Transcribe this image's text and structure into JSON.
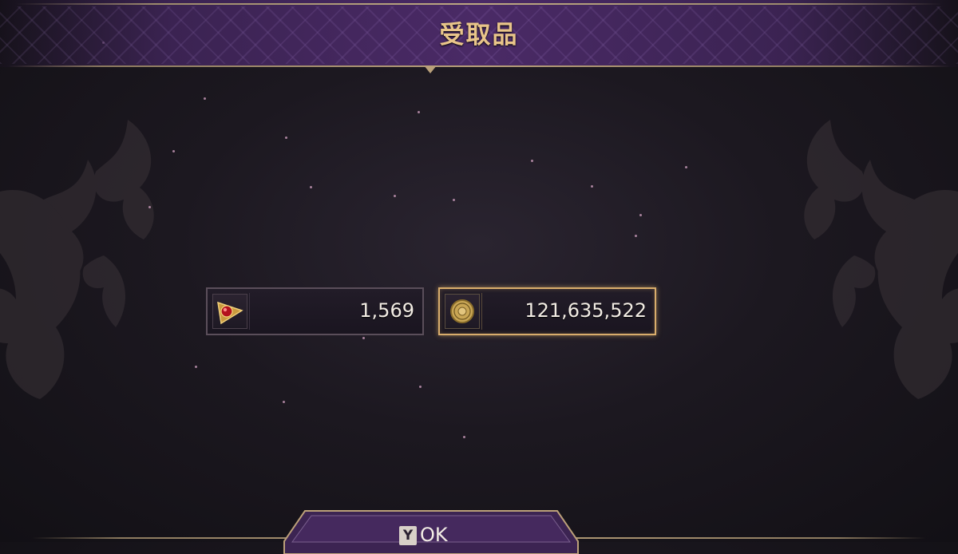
{
  "screen": {
    "title": "受取品"
  },
  "rewards": [
    {
      "icon": "red-gem-icon",
      "amount": "1,569",
      "selected": false
    },
    {
      "icon": "gold-coin-icon",
      "amount": "121,635,522",
      "selected": true
    }
  ],
  "ok_button": {
    "key_hint": "Y",
    "label": "OK"
  },
  "colors": {
    "title": "#e9c58a",
    "header_purple": "#4a2a66",
    "selected_border": "#d9ad6c",
    "background": "#1c1820"
  }
}
